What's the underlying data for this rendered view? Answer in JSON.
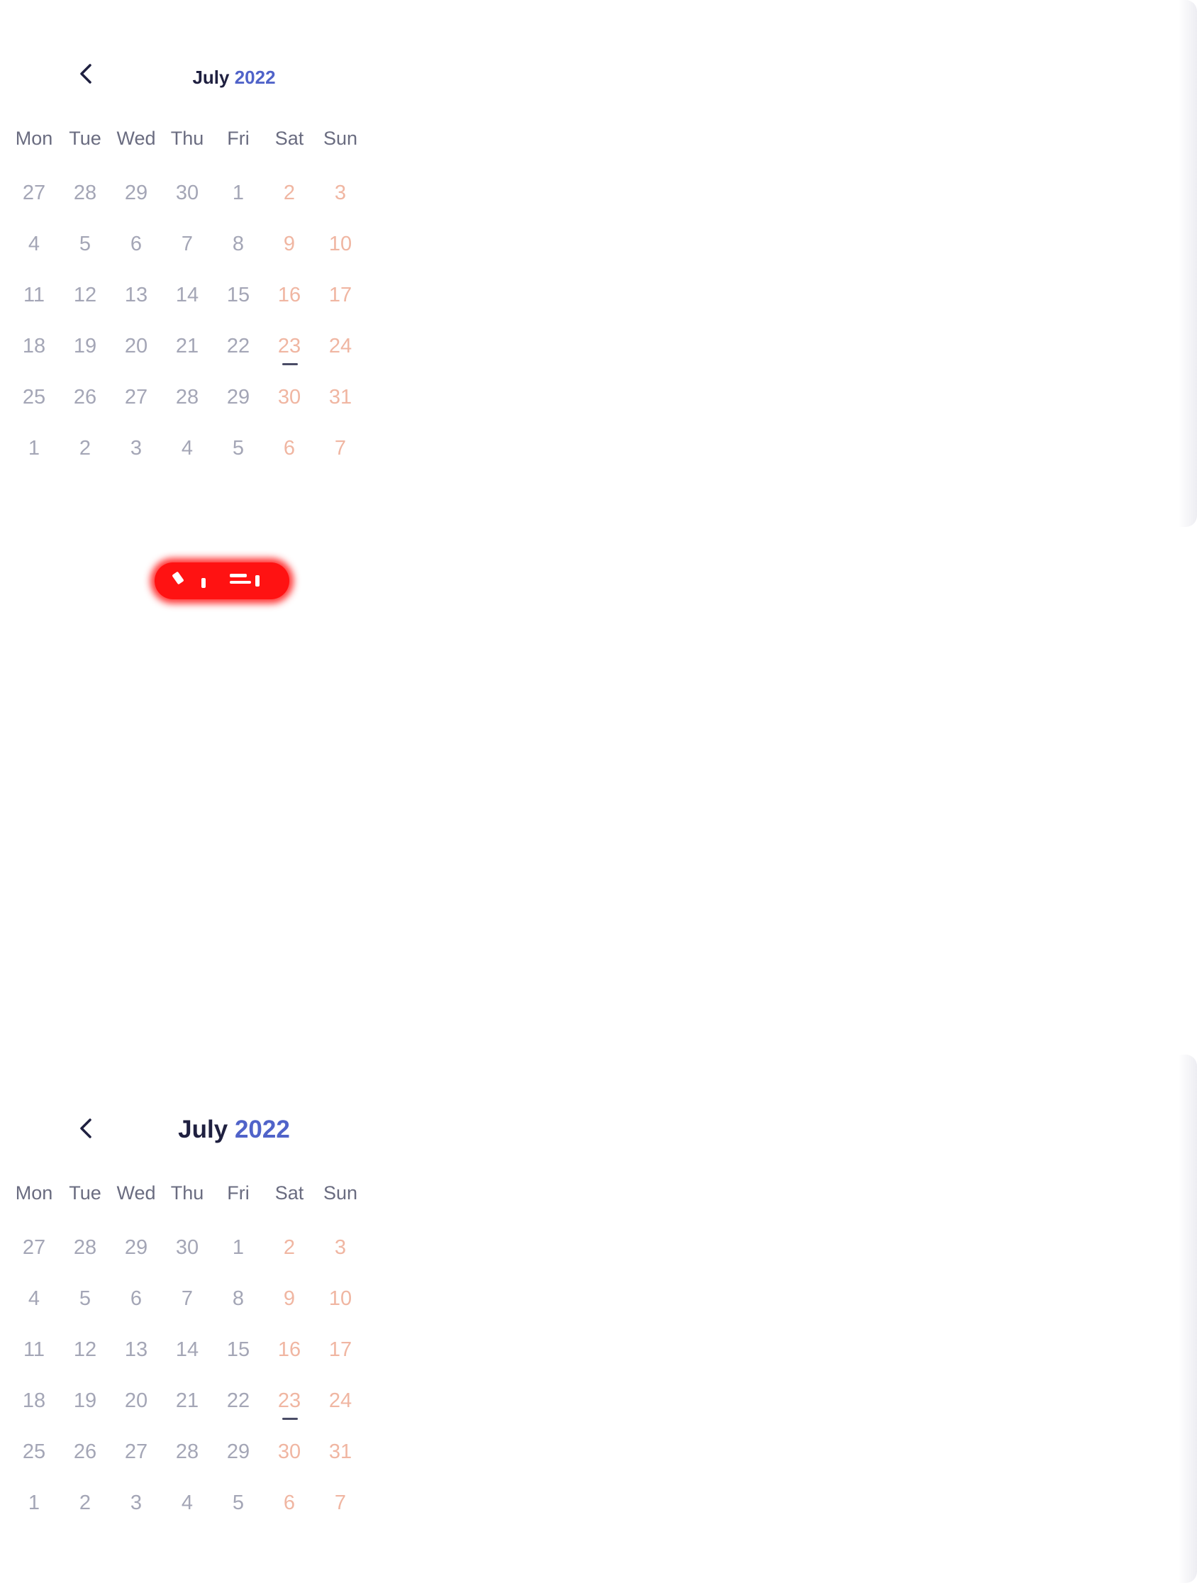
{
  "calendars": [
    {
      "month": "July",
      "year": "2022",
      "weekdays": [
        "Mon",
        "Tue",
        "Wed",
        "Thu",
        "Fri",
        "Sat",
        "Sun"
      ],
      "today": "23",
      "weeks": [
        [
          "27",
          "28",
          "29",
          "30",
          "1",
          "2",
          "3"
        ],
        [
          "4",
          "5",
          "6",
          "7",
          "8",
          "9",
          "10"
        ],
        [
          "11",
          "12",
          "13",
          "14",
          "15",
          "16",
          "17"
        ],
        [
          "18",
          "19",
          "20",
          "21",
          "22",
          "23",
          "24"
        ],
        [
          "25",
          "26",
          "27",
          "28",
          "29",
          "30",
          "31"
        ],
        [
          "1",
          "2",
          "3",
          "4",
          "5",
          "6",
          "7"
        ]
      ]
    },
    {
      "month": "July",
      "year": "2022",
      "weekdays": [
        "Mon",
        "Tue",
        "Wed",
        "Thu",
        "Fri",
        "Sat",
        "Sun"
      ],
      "today": "23",
      "weeks": [
        [
          "27",
          "28",
          "29",
          "30",
          "1",
          "2",
          "3"
        ],
        [
          "4",
          "5",
          "6",
          "7",
          "8",
          "9",
          "10"
        ],
        [
          "11",
          "12",
          "13",
          "14",
          "15",
          "16",
          "17"
        ],
        [
          "18",
          "19",
          "20",
          "21",
          "22",
          "23",
          "24"
        ],
        [
          "25",
          "26",
          "27",
          "28",
          "29",
          "30",
          "31"
        ],
        [
          "1",
          "2",
          "3",
          "4",
          "5",
          "6",
          "7"
        ]
      ]
    }
  ],
  "icons": {
    "back": "chevron-left-icon"
  },
  "colors": {
    "title": "#1f2040",
    "year_accent": "#5063c9",
    "weekday_text": "#6a6c80",
    "day_text": "#a4a6b6",
    "weekend_text": "#f0b6a2",
    "today_underline": "#4a4c66",
    "annotation_mark": "#ff1212"
  }
}
